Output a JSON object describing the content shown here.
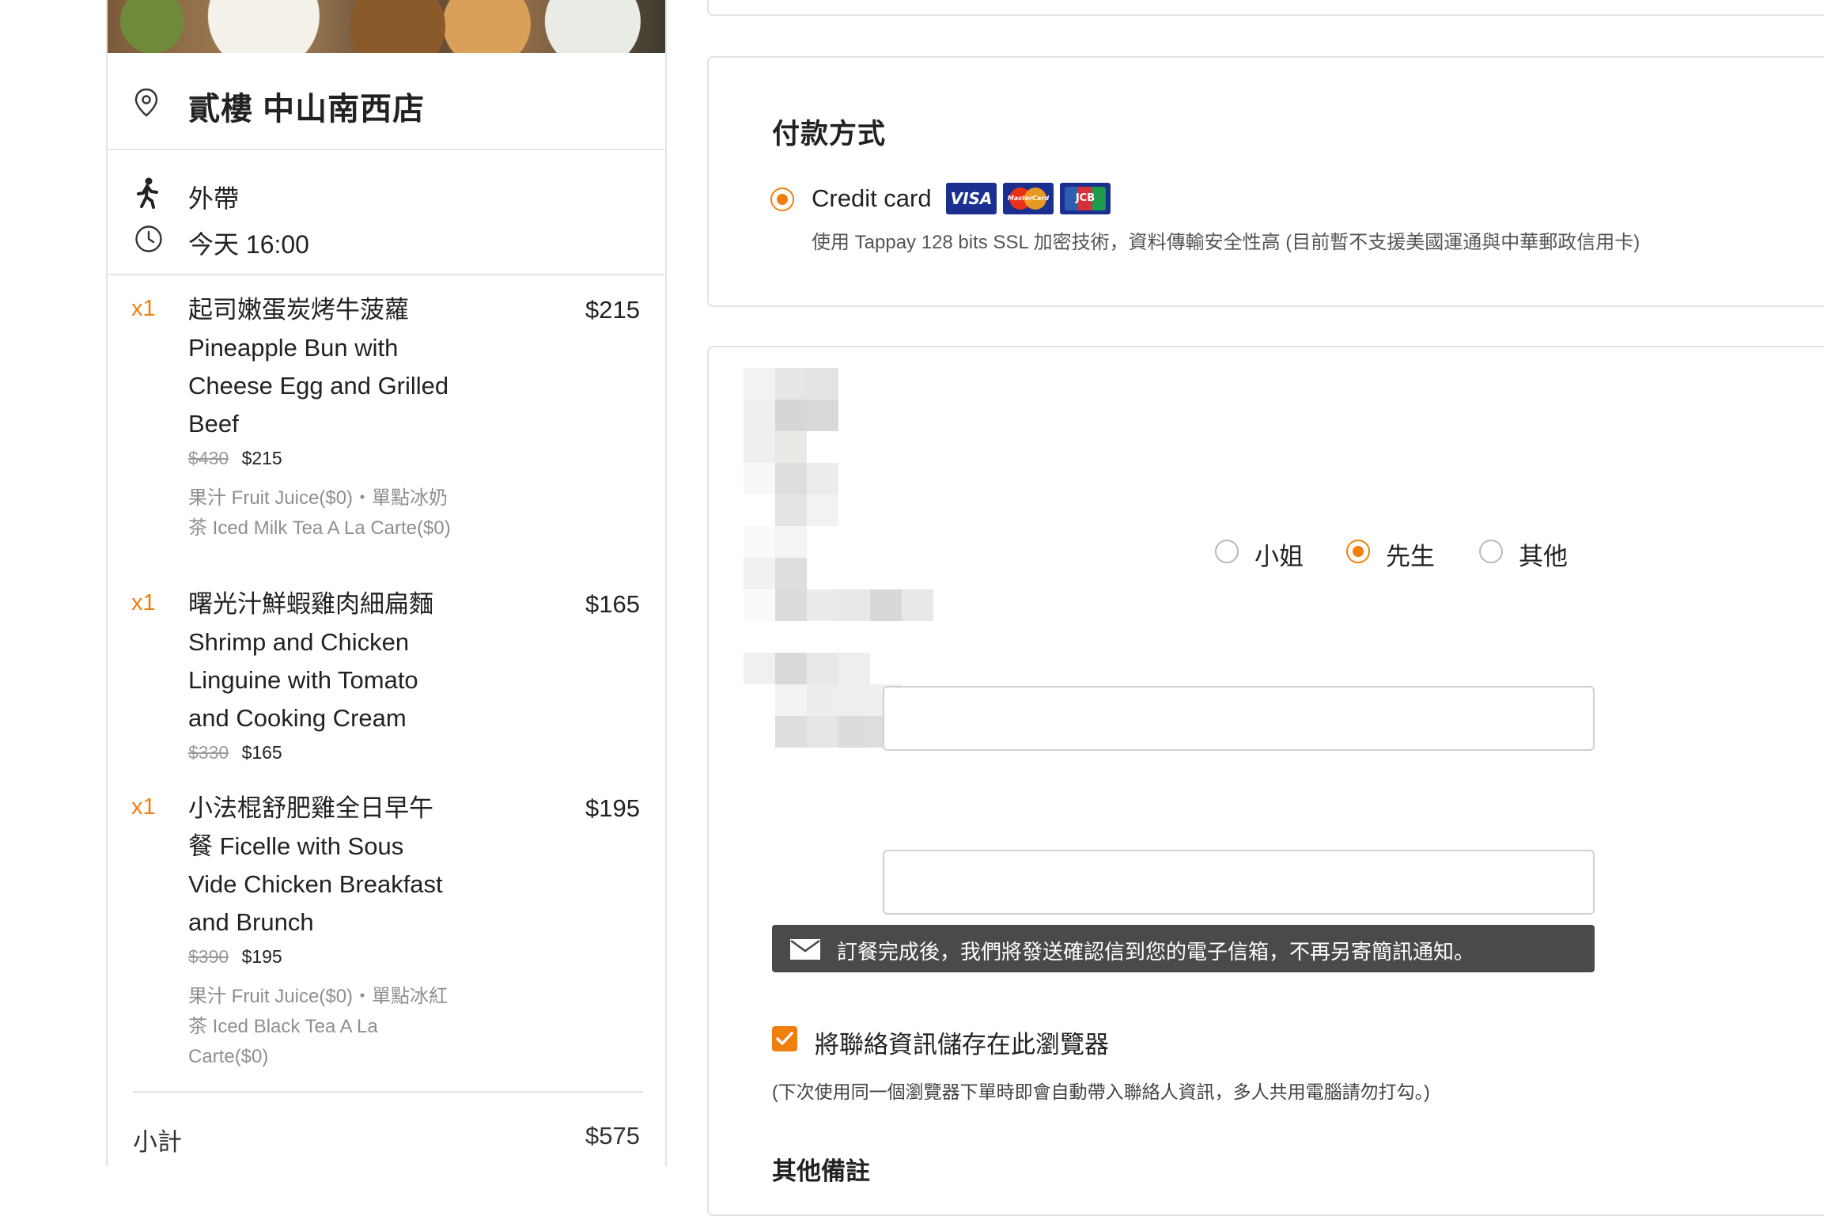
{
  "store": {
    "name": "貳樓 中山南西店",
    "pickup_label": "外帶",
    "pickup_time": "今天 16:00"
  },
  "items": [
    {
      "qty": "x1",
      "name": "起司嫩蛋炭烤牛菠蘿 Pineapple Bun with Cheese Egg and Grilled Beef",
      "price": "$215",
      "old_price": "$430",
      "new_price": "$215",
      "options": "果汁 Fruit Juice($0)・單點冰奶茶 Iced Milk Tea A La Carte($0)"
    },
    {
      "qty": "x1",
      "name": "曙光汁鮮蝦雞肉細扁麵 Shrimp and Chicken Linguine with Tomato and Cooking Cream",
      "price": "$165",
      "old_price": "$330",
      "new_price": "$165",
      "options": ""
    },
    {
      "qty": "x1",
      "name": "小法棍舒肥雞全日早午餐 Ficelle with Sous Vide Chicken Breakfast and Brunch",
      "price": "$195",
      "old_price": "$390",
      "new_price": "$195",
      "options": "果汁 Fruit Juice($0)・單點冰紅茶 Iced Black Tea A La Carte($0)"
    }
  ],
  "summary": {
    "subtotal_label": "小計",
    "subtotal_value": "$575"
  },
  "payment": {
    "title": "付款方式",
    "method_label": "Credit card",
    "card_logos": [
      "VISA",
      "MasterCard",
      "JCB"
    ],
    "mastercard_text": "MasterCard",
    "jcb_text": "JCB",
    "description": "使用 Tappay 128 bits SSL 加密技術，資料傳輸安全性高 (目前暫不支援美國運通與中華郵政信用卡)"
  },
  "contact": {
    "gender_options": [
      "小姐",
      "先生",
      "其他"
    ],
    "gender_selected": "先生",
    "email_notice": "訂餐完成後，我們將發送確認信到您的電子信箱，不再另寄簡訊通知。",
    "save_label": "將聯絡資訊儲存在此瀏覽器",
    "save_checked": true,
    "save_hint": "(下次使用同一個瀏覽器下單時即會自動帶入聯絡人資訊，多人共用電腦請勿打勾。)",
    "other_title": "其他備註"
  },
  "colors": {
    "accent": "#f07f0e",
    "notice_bg": "#4a4a4a",
    "card_brand": "#1a2f8f"
  },
  "icons": {
    "store": "location-pin-icon",
    "pickup": "walking-person-icon",
    "time": "clock-icon",
    "notice": "mail-icon"
  }
}
